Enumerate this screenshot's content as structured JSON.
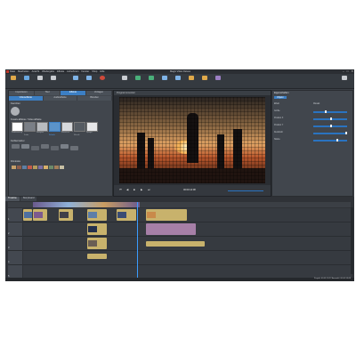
{
  "window": {
    "title": "Magix Video Deluxe",
    "menu": [
      "Datei",
      "Bearbeiten",
      "Ansicht",
      "Wiedergabe",
      "Effekte",
      "Aufnehmen",
      "Fenster",
      "Shop",
      "Hilfe"
    ],
    "controls": [
      "–",
      "□",
      "✕"
    ]
  },
  "toolbar": {
    "buttons": [
      {
        "label": "Öffnen",
        "icon": "folder-icon",
        "color": "#e0a94a"
      },
      {
        "label": "Speichern",
        "icon": "save-icon",
        "color": "#6aa8e0"
      },
      {
        "label": "Rückgängig",
        "icon": "undo-icon",
        "color": "#c9ccd1"
      },
      {
        "label": "Wiederherstellen",
        "icon": "redo-icon",
        "color": "#c9ccd1"
      },
      {
        "label": "Projekt",
        "icon": "project-icon",
        "color": "#7fb3e6"
      },
      {
        "label": "Mediapool",
        "icon": "media-icon",
        "color": "#7fb3e6"
      },
      {
        "label": "Aufnahme",
        "icon": "record-icon",
        "color": "#d04a3a"
      },
      {
        "label": "Schneiden",
        "icon": "cut-icon",
        "color": "#c9ccd1"
      },
      {
        "label": "Trimmen",
        "icon": "trim-icon",
        "color": "#4ab07a"
      },
      {
        "label": "Zeitleiste",
        "icon": "timeline-icon",
        "color": "#4ab07a"
      },
      {
        "label": "Storyboard",
        "icon": "storyboard-icon",
        "color": "#7fb3e6"
      },
      {
        "label": "Szenenübersicht",
        "icon": "scenes-icon",
        "color": "#7fb3e6"
      },
      {
        "label": "Ausgabe",
        "icon": "export-icon",
        "color": "#e0a94a"
      },
      {
        "label": "Brennen",
        "icon": "burn-icon",
        "color": "#e0a94a"
      },
      {
        "label": "Online",
        "icon": "upload-icon",
        "color": "#9c7fc4"
      }
    ],
    "right_button": "Export-Assistent"
  },
  "left_panel": {
    "tabs": [
      "Importieren",
      "Titel",
      "Effekte",
      "Vorlagen"
    ],
    "subtabs": [
      "Videoeffekte",
      "Audioeffekte",
      "Blenden"
    ],
    "section1": "Favoriten",
    "section2": "Kreativ-Effekte / Video-Effekte",
    "effects": [
      "Stabilisierung",
      "Farbe",
      "Helligkeit",
      "Schärfe",
      "Rauschen",
      "Mosaik",
      "Spiegel"
    ],
    "section3": "Farbkorrektur",
    "section4": "Filmlooks"
  },
  "preview": {
    "title": "Programmmonitor",
    "timecode": "00:00:14:08",
    "controls": [
      "⏮",
      "◀",
      "■",
      "▶",
      "⏭"
    ]
  },
  "right_panel": {
    "title": "Eigenschaften",
    "tab": "Objekt",
    "rows": [
      {
        "label": "Effekt",
        "value": "Mosaik"
      },
      {
        "label": "Größe",
        "value": "35"
      },
      {
        "label": "Position X",
        "value": "50"
      },
      {
        "label": "Position Y",
        "value": "50"
      },
      {
        "label": "Deckkraft",
        "value": "100"
      },
      {
        "label": "Stärke",
        "value": "70"
      }
    ]
  },
  "timeline": {
    "tabs": [
      "Timeline",
      "Storyboard"
    ],
    "tracks": [
      "1",
      "2",
      "3",
      "4",
      "5"
    ],
    "status": "Projekt: 00:01:24:12   Auswahl: 00:00:14:08"
  }
}
